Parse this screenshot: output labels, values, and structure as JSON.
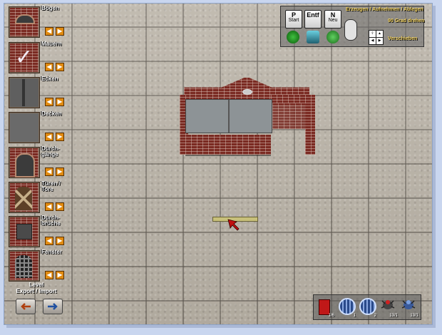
{
  "palette": {
    "categories": [
      {
        "label": "Bögen",
        "icon": "brick-arch-icon"
      },
      {
        "label": "Mauern",
        "icon": "checkmark-icon"
      },
      {
        "label": "Ecken",
        "icon": "corner-icon"
      },
      {
        "label": "Decken",
        "icon": "ceiling-icon"
      },
      {
        "label": "Durch-\ngänge",
        "icon": "passage-icon"
      },
      {
        "label": "Türen /\nTore",
        "icon": "door-icon"
      },
      {
        "label": "Durch-\nbrüche",
        "icon": "opening-icon"
      },
      {
        "label": "Fenster",
        "icon": "window-grate-icon"
      }
    ],
    "arrow_left": "◀",
    "arrow_right": "▶",
    "level": {
      "title": "Level",
      "export_label": "Export",
      "separator": "/",
      "import_label": "Import"
    }
  },
  "help": {
    "keys": [
      {
        "key": "P",
        "sub": "Start"
      },
      {
        "key": "Entf",
        "sub": ""
      },
      {
        "key": "N",
        "sub": "Neu"
      }
    ],
    "mouse_text": "Erzeugen / Aufnehmen / Ablegen",
    "rotate_text": "90 Grad drehen",
    "move_text": "Verschieben"
  },
  "toolbar": {
    "tools": [
      {
        "icon": "red-cube-icon",
        "number": "1/6"
      },
      {
        "icon": "gear-wheel-icon",
        "number": "1"
      },
      {
        "icon": "gear-wheel-icon",
        "number": "2"
      },
      {
        "icon": "red-bug-icon",
        "number": "13/1"
      },
      {
        "icon": "blue-bug-icon",
        "number": "13/1"
      }
    ]
  },
  "colors": {
    "accent_orange": "#e08a10",
    "brick": "#7a2a22",
    "help_text": "#f0d060"
  }
}
